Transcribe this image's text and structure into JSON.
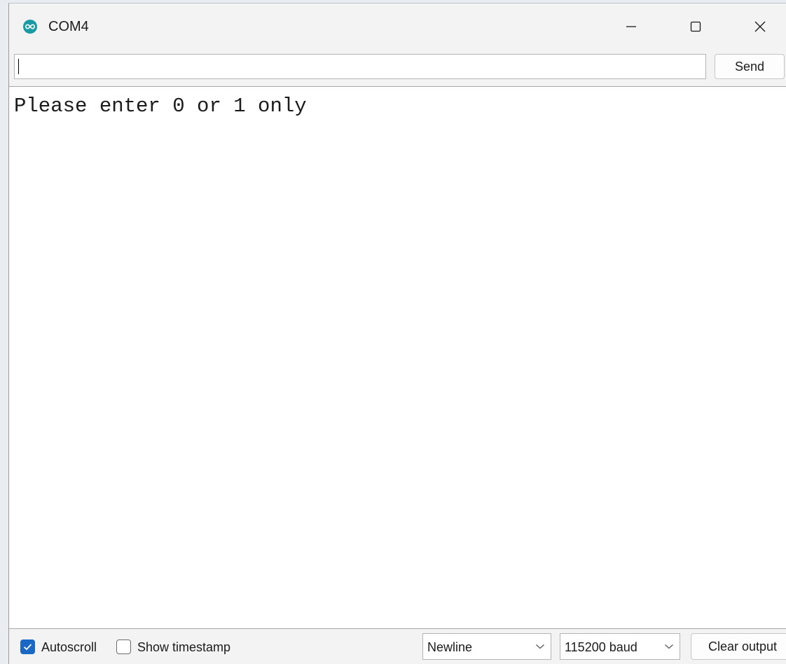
{
  "window": {
    "title": "COM4",
    "app_icon": "arduino-infinity-icon",
    "controls": {
      "minimize_icon": "minimize-icon",
      "maximize_icon": "maximize-icon",
      "close_icon": "close-icon"
    }
  },
  "send_bar": {
    "input_value": "",
    "send_label": "Send"
  },
  "output": {
    "lines": [
      "Please enter 0 or 1 only"
    ]
  },
  "footer": {
    "autoscroll": {
      "label": "Autoscroll",
      "checked": true
    },
    "timestamp": {
      "label": "Show timestamp",
      "checked": false
    },
    "line_ending": {
      "selected": "Newline"
    },
    "baud_rate": {
      "selected": "115200 baud"
    },
    "clear_label": "Clear output"
  },
  "colors": {
    "accent": "#1a67c4",
    "app_icon": "#1a9aa3"
  }
}
